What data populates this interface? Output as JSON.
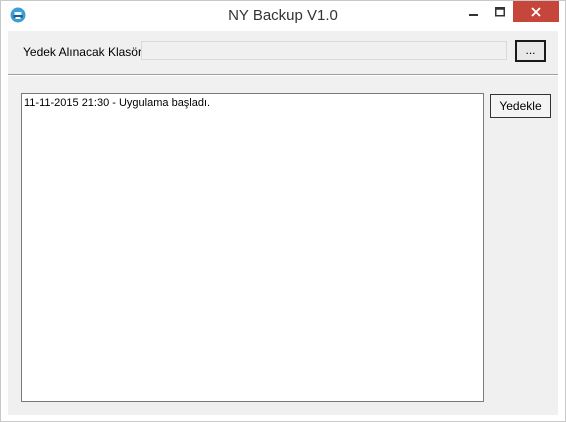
{
  "window": {
    "title": "NY Backup V1.0",
    "close_color": "#c7463c"
  },
  "folder": {
    "label": "Yedek Alınacak Klasör",
    "value": "",
    "browse_label": "..."
  },
  "log": {
    "lines": [
      "11-11-2015 21:30 - Uygulama başladı."
    ]
  },
  "actions": {
    "backup_label": "Yedekle"
  },
  "icons": {
    "app": "printer-app-icon",
    "minimize": "minimize-icon",
    "maximize": "maximize-icon",
    "close": "close-icon"
  }
}
